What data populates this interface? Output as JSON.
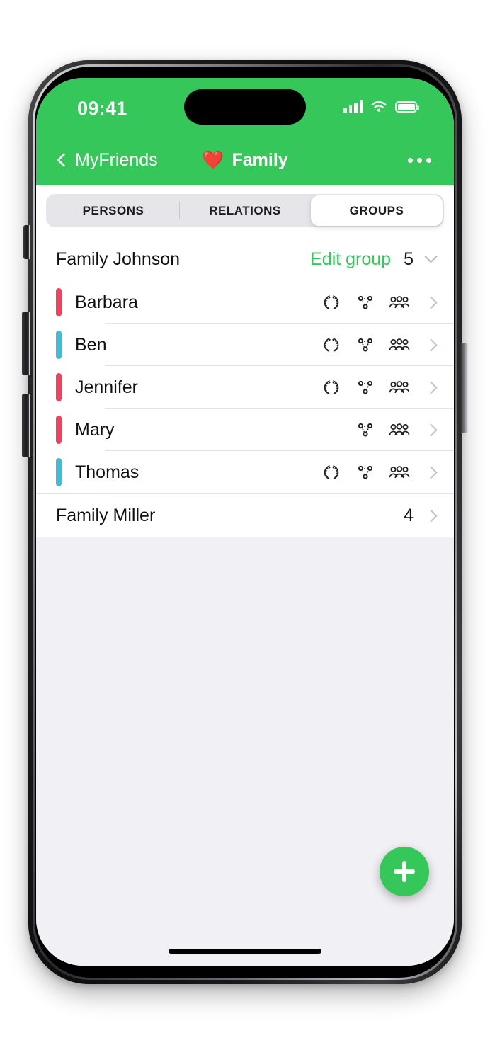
{
  "status_bar": {
    "time": "09:41",
    "signal_icon": "cellular-bars-icon",
    "wifi_icon": "wifi-icon",
    "battery_icon": "battery-icon"
  },
  "nav_bar": {
    "back_icon": "chevron-left-icon",
    "back_label": "MyFriends",
    "title_emoji": "❤️",
    "title": "Family",
    "more_icon": "ellipsis-icon"
  },
  "tabs": [
    {
      "label": "PERSONS",
      "active": false
    },
    {
      "label": "RELATIONS",
      "active": false
    },
    {
      "label": "GROUPS",
      "active": true
    }
  ],
  "groups": [
    {
      "name": "Family Johnson",
      "edit_label": "Edit group",
      "count": "5",
      "expanded": true,
      "expand_icon": "chevron-down-icon",
      "members": [
        {
          "name": "Barbara",
          "color": "#F43F5E",
          "icons": [
            "laurel-wreath-icon",
            "relations-graph-icon",
            "people-group-icon"
          ],
          "chevron": "chevron-right-icon"
        },
        {
          "name": "Ben",
          "color": "#3CBFD6",
          "icons": [
            "laurel-wreath-icon",
            "relations-graph-icon",
            "people-group-icon"
          ],
          "chevron": "chevron-right-icon"
        },
        {
          "name": "Jennifer",
          "color": "#F43F5E",
          "icons": [
            "laurel-wreath-icon",
            "relations-graph-icon",
            "people-group-icon"
          ],
          "chevron": "chevron-right-icon"
        },
        {
          "name": "Mary",
          "color": "#F43F5E",
          "icons": [
            "relations-graph-icon",
            "people-group-icon"
          ],
          "chevron": "chevron-right-icon"
        },
        {
          "name": "Thomas",
          "color": "#3CBFD6",
          "icons": [
            "laurel-wreath-icon",
            "relations-graph-icon",
            "people-group-icon"
          ],
          "chevron": "chevron-right-icon"
        }
      ]
    },
    {
      "name": "Family Miller",
      "count": "4",
      "expanded": false,
      "expand_icon": "chevron-right-icon",
      "members": []
    }
  ],
  "fab": {
    "icon": "plus-icon",
    "label": "Add"
  },
  "colors": {
    "brand_green": "#35C759",
    "female_pink": "#F43F5E",
    "male_cyan": "#3CBFD6",
    "page_bg": "#F0F0F5",
    "list_bg": "#FFFFFF",
    "segment_track": "#E5E5EA"
  }
}
